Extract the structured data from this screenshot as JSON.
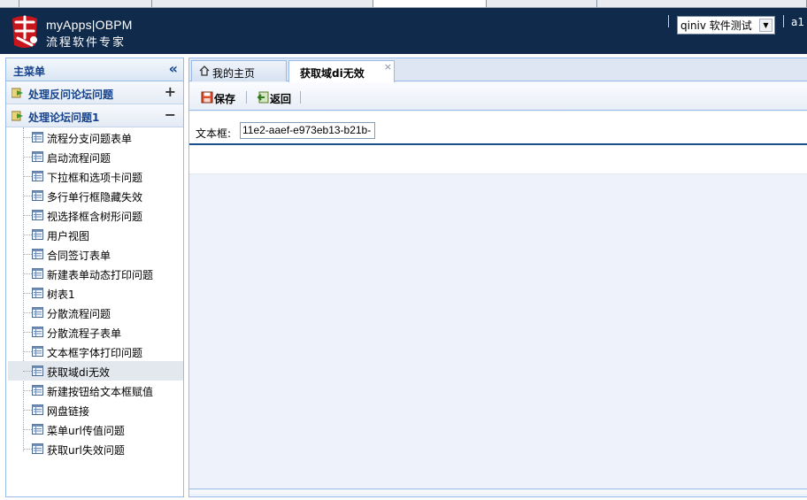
{
  "header": {
    "brand_title": "myApps|OBPM",
    "brand_subtitle": "流程软件专家",
    "user_select_value": "qiniv 软件测试",
    "user_name": "a1"
  },
  "sidebar": {
    "title": "主菜单",
    "collapse_glyph": "«",
    "groups": [
      {
        "label": "处理反问论坛问题",
        "toggle": "+"
      },
      {
        "label": "处理论坛问题1",
        "toggle": "−"
      }
    ],
    "items": [
      "流程分支问题表单",
      "启动流程问题",
      "下拉框和选项卡问题",
      "多行单行框隐藏失效",
      "视选择框含树形问题",
      "用户视图",
      "合同签订表单",
      "新建表单动态打印问题",
      "树表1",
      "分散流程问题",
      "分散流程子表单",
      "文本框字体打印问题",
      "获取域di无效",
      "新建按钮给文本框赋值",
      "网盘链接",
      "菜单url传值问题",
      "获取url失效问题"
    ],
    "selected_index": 12
  },
  "tabs": {
    "home_label": "我的主页",
    "active_label": "获取域di无效",
    "close_glyph": "×"
  },
  "toolbar": {
    "save_label": "保存",
    "back_label": "返回"
  },
  "form": {
    "field_label": "文本框:",
    "field_value": "11e2-aaef-e973eb13-b21b-"
  },
  "icons": {
    "logo": "tianhu-logo-icon",
    "group": "folder-arrow-icon",
    "item": "form-icon",
    "home": "home-icon",
    "save": "save-icon",
    "back": "back-icon"
  },
  "colors": {
    "header_bg": "#0f2a4a",
    "panel_border": "#99bbe8",
    "group_label": "#15428b",
    "content_bg": "#eef2fa"
  }
}
